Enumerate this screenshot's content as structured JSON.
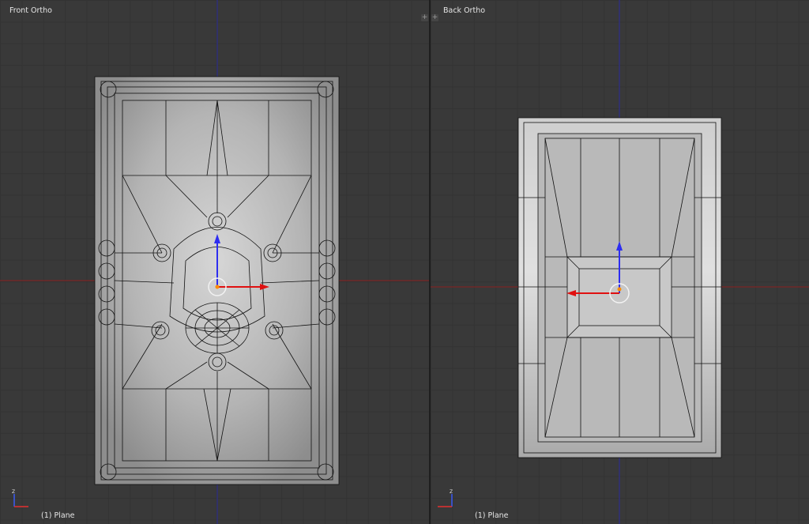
{
  "viewports": {
    "left": {
      "title": "Front Ortho",
      "object_label": "(1) Plane"
    },
    "right": {
      "title": "Back Ortho",
      "object_label": "(1) Plane"
    }
  },
  "controls": {
    "split_button": "+"
  },
  "colors": {
    "background": "#393939",
    "grid": "#333333",
    "x_axis": "#8b2020",
    "y_axis": "#2c2c9a",
    "mesh_fill": "#a9a9a9",
    "wire": "#000000",
    "origin": "#ff8c00"
  },
  "icons": {
    "gizmo": "axis-gizmo-icon",
    "manipulator": "transform-manipulator-icon"
  }
}
